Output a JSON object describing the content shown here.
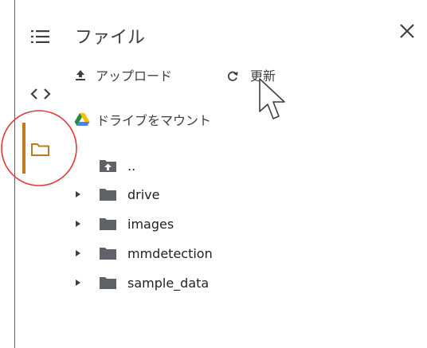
{
  "panel": {
    "title": "ファイル",
    "close_icon": "close-icon"
  },
  "actions": {
    "upload_label": "アップロード",
    "refresh_label": "更新",
    "mount_drive_label": "ドライブをマウント"
  },
  "sidebar": {
    "items": [
      {
        "icon": "table-of-contents-icon",
        "active": false
      },
      {
        "icon": "code-brackets-icon",
        "active": false
      },
      {
        "icon": "folder-icon",
        "active": true
      }
    ]
  },
  "tree": {
    "parent_label": "..",
    "items": [
      {
        "label": "drive"
      },
      {
        "label": "images"
      },
      {
        "label": "mmdetection"
      },
      {
        "label": "sample_data"
      }
    ]
  },
  "colors": {
    "accent": "#c07a1e",
    "annotation_circle": "#e53935",
    "folder_gray": "#5f6368"
  }
}
